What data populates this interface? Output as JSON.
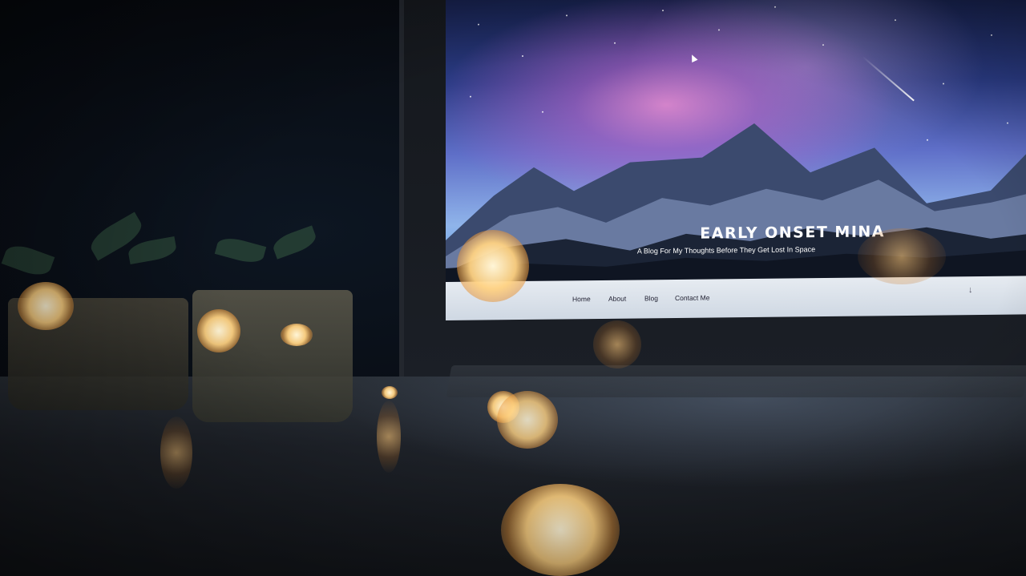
{
  "site": {
    "title": "EARLY ONSET MINA",
    "tagline": "A Blog For My Thoughts Before They Get Lost In Space"
  },
  "nav": {
    "items": [
      "Home",
      "About",
      "Blog",
      "Contact Me"
    ],
    "scroll_arrow": "↓"
  },
  "colors": {
    "sky_top": "#16204a",
    "nebula": "#ec8cd2",
    "navbar": "#e6ebf1",
    "bokeh": "#ffd282"
  }
}
